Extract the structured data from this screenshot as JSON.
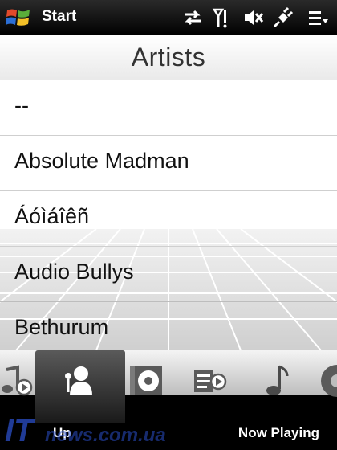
{
  "statusbar": {
    "start_label": "Start",
    "icons": [
      "windows-flag-icon",
      "sync-arrows-icon",
      "signal-icon",
      "mute-volume-icon",
      "plug-charging-icon",
      "menu-list-icon"
    ]
  },
  "header": {
    "title": "Artists"
  },
  "artists": [
    {
      "label": "--"
    },
    {
      "label": "Absolute Madman"
    },
    {
      "label": "Áóìáîêñ"
    },
    {
      "label": "Audio Bullys"
    },
    {
      "label": "Bethurum"
    }
  ],
  "dock": {
    "icons": [
      "music-play-icon",
      "artist-icon",
      "album-disc-icon",
      "playlist-icon",
      "music-note-icon",
      "disc-icon"
    ],
    "active": "artist-icon"
  },
  "softkeys": {
    "left": "Up",
    "right": "Now Playing"
  },
  "watermark": {
    "text": "ITnews.com.ua"
  },
  "colors": {
    "statusbar": "#000000",
    "dock_active": "#2a2a2a",
    "watermark_blue": "#2b4fc8"
  }
}
